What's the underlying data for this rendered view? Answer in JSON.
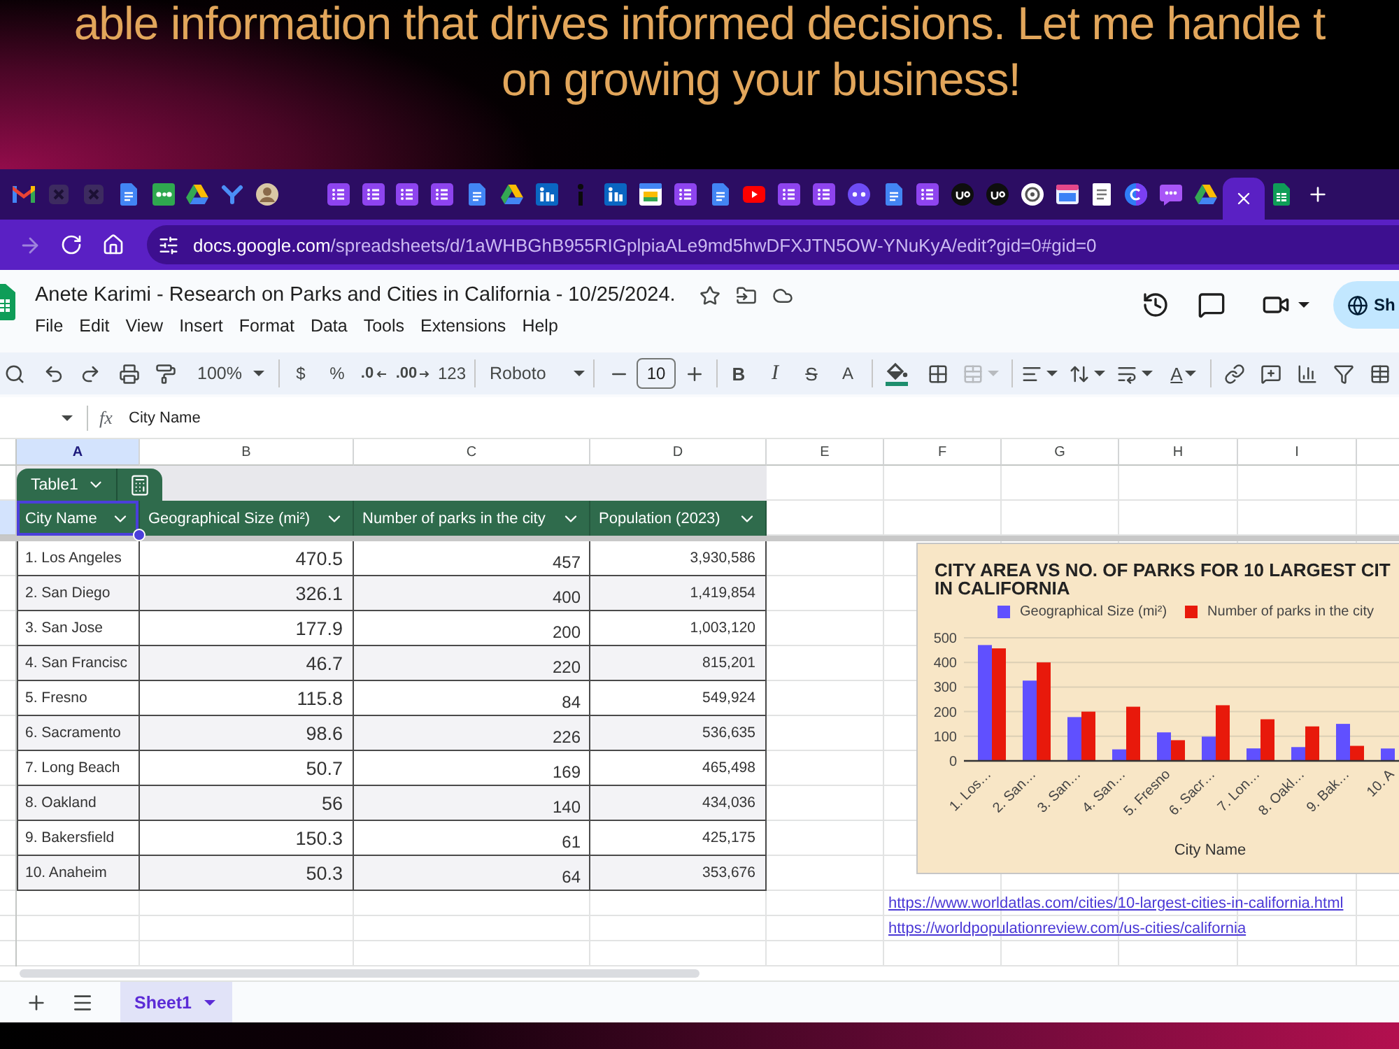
{
  "banner": {
    "lines": [
      "able information that drives informed decisions. Let me handle t",
      "on growing your business!"
    ]
  },
  "browser": {
    "pinned_tabs": [
      {
        "kind": "mail",
        "selected": false
      },
      {
        "kind": "dim",
        "selected": false
      },
      {
        "kind": "dim",
        "selected": false
      },
      {
        "kind": "document",
        "selected": false
      },
      {
        "kind": "tile",
        "selected": false
      },
      {
        "kind": "triangle",
        "selected": false
      },
      {
        "kind": "fork",
        "selected": false
      },
      {
        "kind": "avatar",
        "selected": false
      }
    ],
    "tabs": [
      {
        "kind": "list",
        "selected": false
      },
      {
        "kind": "list",
        "selected": false
      },
      {
        "kind": "list",
        "selected": false
      },
      {
        "kind": "list",
        "selected": false
      },
      {
        "kind": "document",
        "selected": false
      },
      {
        "kind": "triangle",
        "selected": false
      },
      {
        "kind": "profile",
        "selected": false
      },
      {
        "kind": "info",
        "selected": false
      },
      {
        "kind": "profile",
        "selected": false
      },
      {
        "kind": "calendar",
        "selected": false
      },
      {
        "kind": "list",
        "selected": false
      },
      {
        "kind": "document",
        "selected": false
      },
      {
        "kind": "video",
        "selected": false
      },
      {
        "kind": "list",
        "selected": false
      },
      {
        "kind": "list",
        "selected": false
      },
      {
        "kind": "dots",
        "selected": false
      },
      {
        "kind": "document",
        "selected": false
      },
      {
        "kind": "list",
        "selected": false
      },
      {
        "kind": "dark_circle",
        "selected": false
      },
      {
        "kind": "dark_circle",
        "selected": false
      },
      {
        "kind": "knot",
        "selected": false
      },
      {
        "kind": "window",
        "selected": false
      },
      {
        "kind": "page",
        "selected": false
      },
      {
        "kind": "c_circle",
        "selected": false
      },
      {
        "kind": "chat",
        "selected": false
      },
      {
        "kind": "triangle",
        "selected": false
      },
      {
        "selected": true
      },
      {
        "kind": "sheet",
        "selected": false
      }
    ],
    "url": "**docs.google.com**/spreadsheets/d/1aWHBGhB955RIGplpiaALe9md5hwDFXJTN5OW-YNuKyA/edit?gid=0#gid=0"
  },
  "doc": {
    "title": "Anete Karimi - Research on Parks and Cities in California - 10/25/2024.",
    "menu": [
      "File",
      "Edit",
      "View",
      "Insert",
      "Format",
      "Data",
      "Tools",
      "Extensions",
      "Help"
    ],
    "share": "Sh"
  },
  "toolbar": {
    "zoom": "100%",
    "currency": "$",
    "percent": "%",
    "decrease_decimal": ".0",
    "increase_decimal": ".00",
    "number_format": "123",
    "font": "Roboto",
    "font_size": "10",
    "bold": "B",
    "italic": "I",
    "strikethrough": "S",
    "text_color": "A",
    "merge_cells": {
      "disabled": true
    },
    "text_rotation": "A"
  },
  "formula_bar": {
    "function_label": "fx",
    "value": "City Name"
  },
  "sheet": {
    "columns": [
      {
        "label": "A",
        "selected": true
      },
      {
        "label": "B",
        "selected": false
      },
      {
        "label": "C",
        "selected": false
      },
      {
        "label": "D",
        "selected": false
      },
      {
        "label": "E",
        "selected": false
      },
      {
        "label": "F",
        "selected": false
      },
      {
        "label": "G",
        "selected": false
      },
      {
        "label": "H",
        "selected": false
      },
      {
        "label": "I",
        "selected": false
      }
    ],
    "links": [
      "https://www.worldatlas.com/cities/10-largest-cities-in-california.html",
      "https://worldpopulationreview.com/us-cities/california"
    ]
  },
  "table": {
    "name": "Table1",
    "columns": [
      {
        "label": "City Name",
        "selected": true
      },
      {
        "label": "Geographical Size (mi²)",
        "selected": false
      },
      {
        "label": "Number of parks in the city",
        "selected": false
      },
      {
        "label": "Population (2023)",
        "selected": false
      }
    ],
    "rows": [
      [
        "1. Los Angeles",
        "470.5",
        "457",
        "3,930,586"
      ],
      [
        "2. San Diego",
        "326.1",
        "400",
        "1,419,854"
      ],
      [
        "3. San Jose",
        "177.9",
        "200",
        "1,003,120"
      ],
      [
        "4. San Francisc",
        "46.7",
        "220",
        "815,201"
      ],
      [
        "5. Fresno",
        "115.8",
        "84",
        "549,924"
      ],
      [
        "6. Sacramento",
        "98.6",
        "226",
        "536,635"
      ],
      [
        "7. Long Beach",
        "50.7",
        "169",
        "465,498"
      ],
      [
        "8. Oakland",
        "56",
        "140",
        "434,036"
      ],
      [
        "9. Bakersfield",
        "150.3",
        "61",
        "425,175"
      ],
      [
        "10. Anaheim",
        "50.3",
        "64",
        "353,676"
      ]
    ]
  },
  "chart": {
    "chart_data": {
      "type": "bar",
      "title": "CITY AREA VS NO. OF PARKS FOR 10 LARGEST CIT\nIN CALIFORNIA",
      "xlabel": "City Name",
      "categories": [
        "1. Los…",
        "2. San…",
        "3. San…",
        "4. San…",
        "5. Fresno",
        "6. Sacr…",
        "7. Lon…",
        "8. Oakl…",
        "9. Bak…",
        "10. A"
      ],
      "series": [
        {
          "name": "Geographical Size (mi²)",
          "color": "#6050ff",
          "values": [
            470.5,
            326.1,
            177.9,
            46.7,
            115.8,
            98.6,
            50.7,
            56,
            150.3,
            50.3
          ]
        },
        {
          "name": "Number of parks in the city",
          "color": "#e8190b",
          "values": [
            457,
            400,
            200,
            220,
            84,
            226,
            169,
            140,
            61,
            null
          ]
        }
      ],
      "ylim": [
        0,
        500
      ],
      "yticks": [
        0,
        100,
        200,
        300,
        400,
        500
      ],
      "grid": true,
      "legend": "top"
    }
  },
  "sheet_tabs": [
    {
      "name": "Sheet1",
      "selected": true
    }
  ]
}
